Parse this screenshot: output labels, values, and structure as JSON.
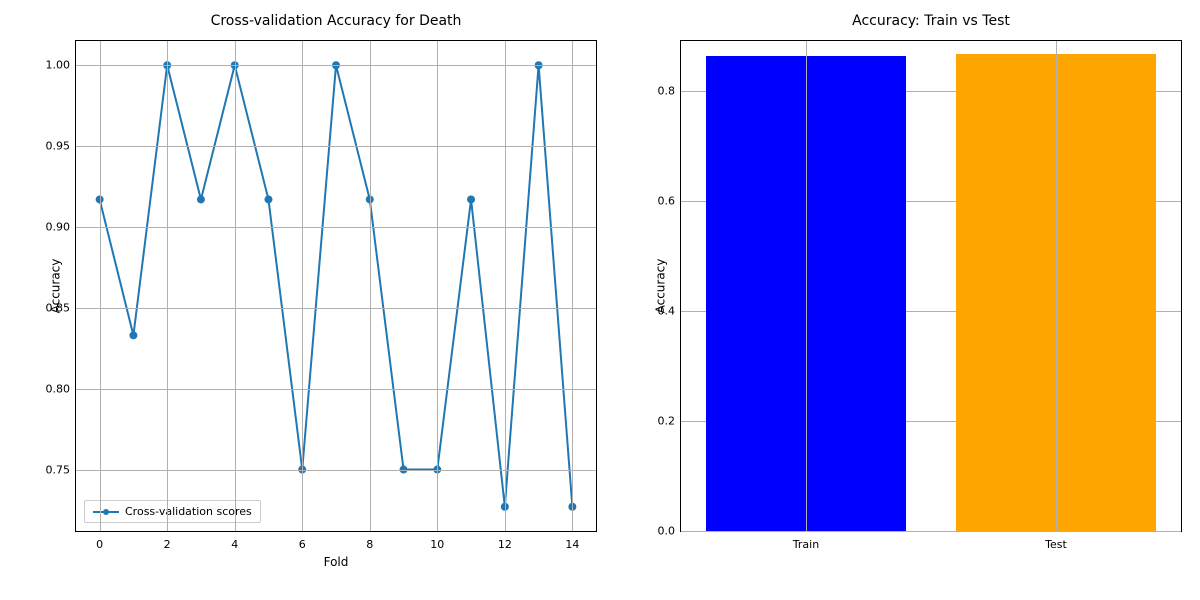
{
  "chart_data": [
    {
      "type": "line",
      "title": "Cross-validation Accuracy for Death",
      "xlabel": "Fold",
      "ylabel": "Accuracy",
      "x": [
        0,
        1,
        2,
        3,
        4,
        5,
        6,
        7,
        8,
        9,
        10,
        11,
        12,
        13,
        14
      ],
      "y": [
        0.917,
        0.833,
        1.0,
        0.917,
        1.0,
        0.917,
        0.75,
        1.0,
        0.917,
        0.75,
        0.75,
        0.917,
        0.727,
        1.0,
        0.727
      ],
      "xlim": [
        -0.7,
        14.7
      ],
      "ylim": [
        0.712,
        1.015
      ],
      "xticks": [
        0,
        2,
        4,
        6,
        8,
        10,
        12,
        14
      ],
      "yticks": [
        0.75,
        0.8,
        0.85,
        0.9,
        0.95,
        1.0
      ],
      "legend": "Cross-validation scores",
      "line_color": "#1f77b4"
    },
    {
      "type": "bar",
      "title": "Accuracy: Train vs Test",
      "xlabel": "",
      "ylabel": "Accuracy",
      "categories": [
        "Train",
        "Test"
      ],
      "values": [
        0.862,
        0.866
      ],
      "colors": [
        "#0000ff",
        "#ffa500"
      ],
      "ylim": [
        0.0,
        0.89
      ],
      "yticks": [
        0.0,
        0.2,
        0.4,
        0.6,
        0.8
      ],
      "xlim": [
        -0.5,
        1.5
      ],
      "bar_width": 0.8
    }
  ]
}
